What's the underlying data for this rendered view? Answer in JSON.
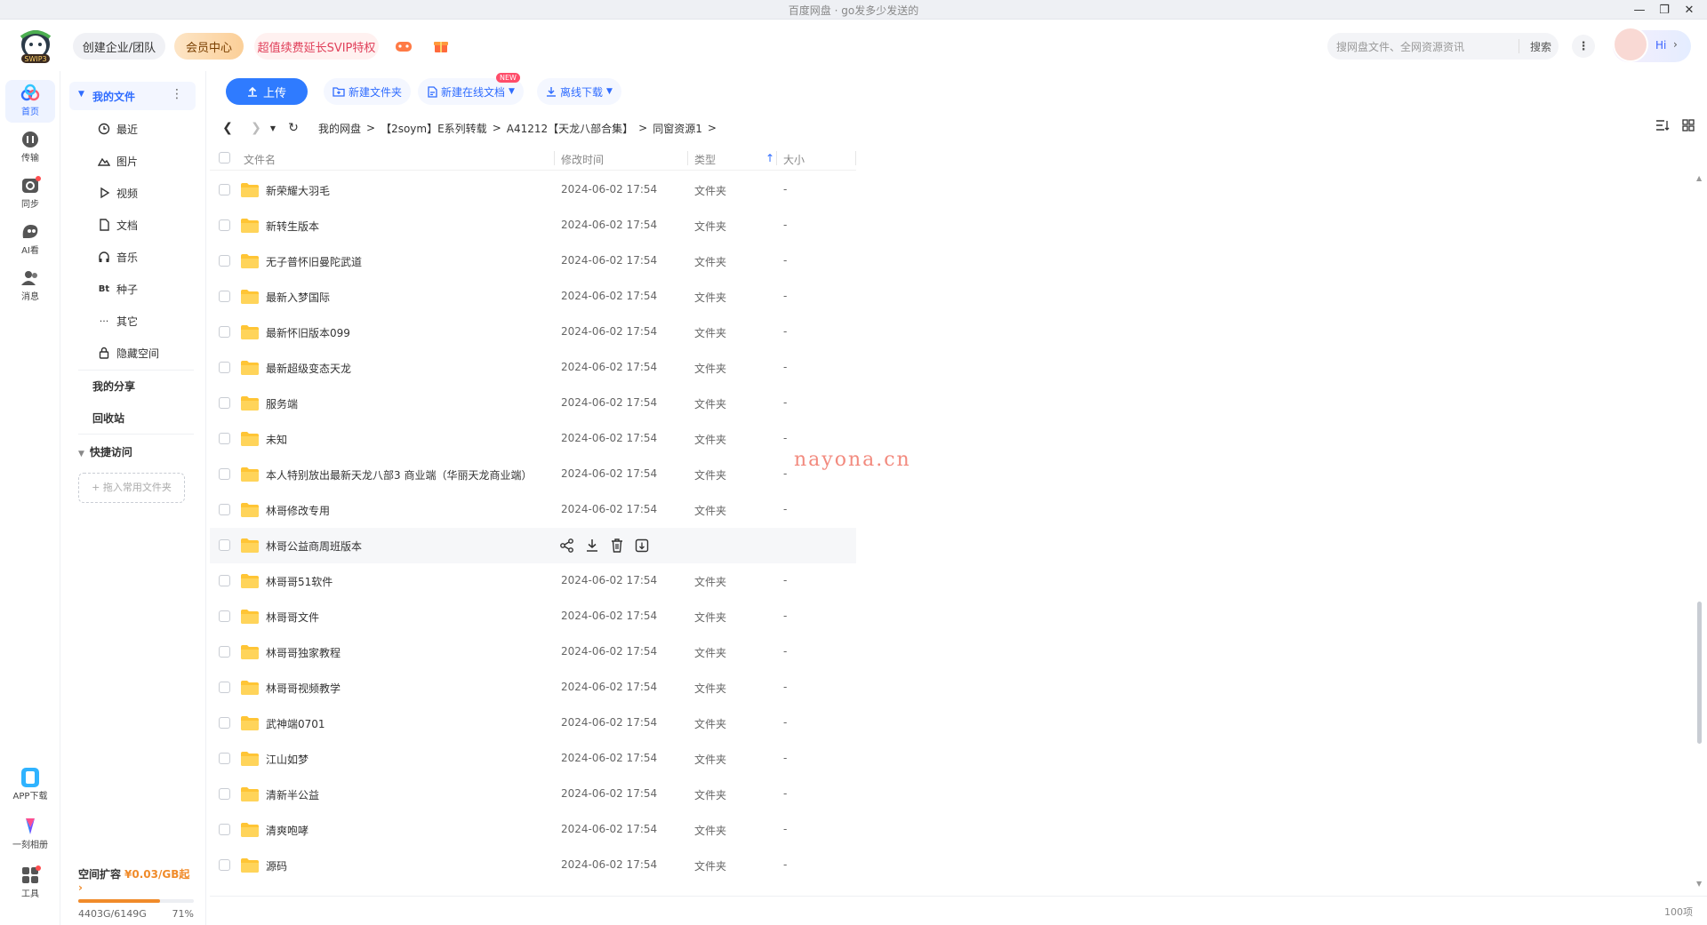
{
  "window": {
    "title": "百度网盘 · go发多少发送的",
    "controls": [
      "minimize",
      "restore",
      "close"
    ]
  },
  "header": {
    "logo_icon": "baidu-netdisk-svip-logo",
    "logo_badge": "SWIP3",
    "team_button": "创建企业/团队",
    "vip_button": "会员中心",
    "promo_button": "超值续费延长SVIP特权",
    "search": {
      "placeholder": "搜网盘文件、全网资源资讯",
      "button": "搜索"
    },
    "greeting": "Hi"
  },
  "rail": {
    "items": [
      {
        "label": "首页",
        "icon": "home-icon",
        "active": true
      },
      {
        "label": "传输",
        "icon": "transfer-icon"
      },
      {
        "label": "同步",
        "icon": "sync-icon"
      },
      {
        "label": "AI看",
        "icon": "ai-icon"
      },
      {
        "label": "消息",
        "icon": "message-icon"
      }
    ],
    "bottom": [
      {
        "label": "APP下载",
        "icon": "app-download-icon"
      },
      {
        "label": "一刻相册",
        "icon": "album-icon"
      },
      {
        "label": "工具",
        "icon": "tools-icon"
      }
    ]
  },
  "nav": {
    "my_files": "我的文件",
    "items": [
      {
        "label": "最近",
        "icon": "clock-icon"
      },
      {
        "label": "图片",
        "icon": "image-icon"
      },
      {
        "label": "视频",
        "icon": "video-icon"
      },
      {
        "label": "文档",
        "icon": "document-icon"
      },
      {
        "label": "音乐",
        "icon": "music-icon"
      },
      {
        "label": "种子",
        "icon": "torrent-icon",
        "glyph": "Bt"
      },
      {
        "label": "其它",
        "icon": "other-icon"
      },
      {
        "label": "隐藏空间",
        "icon": "lock-icon"
      }
    ],
    "my_share": "我的分享",
    "recycle": "回收站",
    "quick_access": "快捷访问",
    "drop_hint": "+ 拖入常用文件夹",
    "storage": {
      "label": "空间扩容",
      "price": "¥0.03/GB起",
      "used": "4403G/6149G",
      "percent_text": "71%",
      "percent": 71,
      "color": "#f08b2a"
    }
  },
  "toolbar": {
    "upload": "上传",
    "new_folder": "新建文件夹",
    "new_doc": "新建在线文档",
    "new_badge": "NEW",
    "offline": "离线下载"
  },
  "breadcrumb": [
    "我的网盘",
    "【2soym】E系列转载",
    "A41212【天龙八部合集】",
    "同窗资源1"
  ],
  "table": {
    "headers": {
      "name": "文件名",
      "date": "修改时间",
      "type": "类型",
      "size": "大小"
    },
    "rows": [
      {
        "name": "新荣耀大羽毛",
        "date": "2024-06-02 17:54",
        "type": "文件夹",
        "size": "-"
      },
      {
        "name": "新转生版本",
        "date": "2024-06-02 17:54",
        "type": "文件夹",
        "size": "-"
      },
      {
        "name": "无子普怀旧曼陀武道",
        "date": "2024-06-02 17:54",
        "type": "文件夹",
        "size": "-"
      },
      {
        "name": "最新入梦国际",
        "date": "2024-06-02 17:54",
        "type": "文件夹",
        "size": "-"
      },
      {
        "name": "最新怀旧版本099",
        "date": "2024-06-02 17:54",
        "type": "文件夹",
        "size": "-"
      },
      {
        "name": "最新超级变态天龙",
        "date": "2024-06-02 17:54",
        "type": "文件夹",
        "size": "-"
      },
      {
        "name": "服务端",
        "date": "2024-06-02 17:54",
        "type": "文件夹",
        "size": "-"
      },
      {
        "name": "未知",
        "date": "2024-06-02 17:54",
        "type": "文件夹",
        "size": "-"
      },
      {
        "name": "本人特别放出最新天龙八部3 商业端（华丽天龙商业端）",
        "date": "2024-06-02 17:54",
        "type": "文件夹",
        "size": "-"
      },
      {
        "name": "林哥修改专用",
        "date": "2024-06-02 17:54",
        "type": "文件夹",
        "size": "-"
      },
      {
        "name": "林哥公益商周班版本",
        "date": "",
        "type": "",
        "size": "",
        "hover": true
      },
      {
        "name": "林哥哥51软件",
        "date": "2024-06-02 17:54",
        "type": "文件夹",
        "size": "-"
      },
      {
        "name": "林哥哥文件",
        "date": "2024-06-02 17:54",
        "type": "文件夹",
        "size": "-"
      },
      {
        "name": "林哥哥独家教程",
        "date": "2024-06-02 17:54",
        "type": "文件夹",
        "size": "-"
      },
      {
        "name": "林哥哥视频教学",
        "date": "2024-06-02 17:54",
        "type": "文件夹",
        "size": "-"
      },
      {
        "name": "武神端0701",
        "date": "2024-06-02 17:54",
        "type": "文件夹",
        "size": "-"
      },
      {
        "name": "江山如梦",
        "date": "2024-06-02 17:54",
        "type": "文件夹",
        "size": "-"
      },
      {
        "name": "清新半公益",
        "date": "2024-06-02 17:54",
        "type": "文件夹",
        "size": "-"
      },
      {
        "name": "清爽咆哮",
        "date": "2024-06-02 17:54",
        "type": "文件夹",
        "size": "-"
      },
      {
        "name": "源码",
        "date": "2024-06-02 17:54",
        "type": "文件夹",
        "size": "-"
      }
    ],
    "hover_actions": [
      "share-icon",
      "download-icon",
      "delete-icon",
      "more-icon"
    ]
  },
  "watermark": "nayona.cn",
  "footer": {
    "count": "100项"
  },
  "colors": {
    "accent": "#2f7bff",
    "folder": "#ffc535",
    "storage": "#f08b2a",
    "watermark": "#f06d5e"
  }
}
